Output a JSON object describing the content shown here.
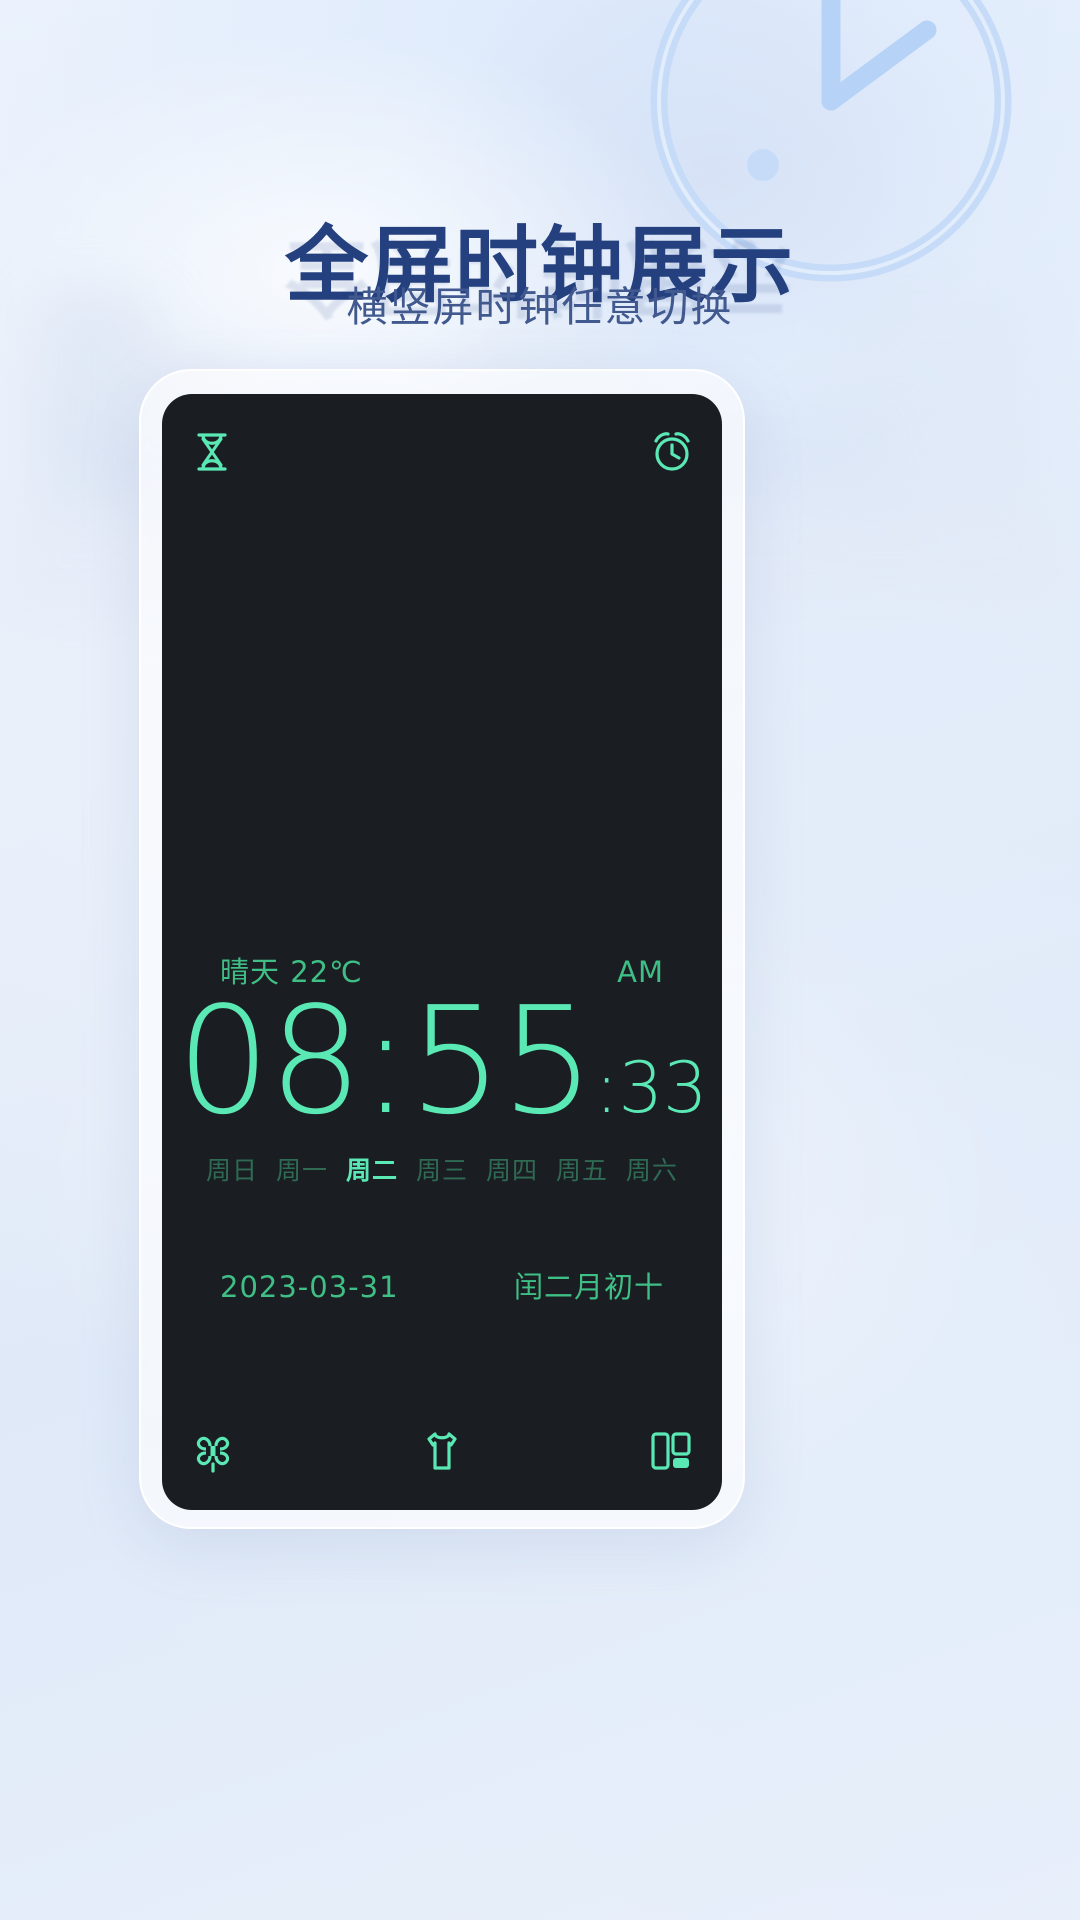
{
  "header": {
    "title": "全屏时钟展示",
    "subtitle": "横竖屏时钟任意切换"
  },
  "colors": {
    "title": "#24407f",
    "subtitle": "#41598f",
    "screen_bg": "#1a1e23",
    "accent_bright": "#5ae8b4",
    "accent_dim": "#3fbf85",
    "weekday_dim": "#2f6b53",
    "page_bg": "#e8f0fb"
  },
  "phone": {
    "topbar": {
      "left_icon": "hourglass-icon",
      "right_icon": "alarm-clock-icon"
    },
    "clock": {
      "weather": "晴天 22℃",
      "meridiem": "AM",
      "time": "08:55",
      "seconds": ":33",
      "weekdays": [
        {
          "label": "周日",
          "active": false
        },
        {
          "label": "周一",
          "active": false
        },
        {
          "label": "周二",
          "active": true
        },
        {
          "label": "周三",
          "active": false
        },
        {
          "label": "周四",
          "active": false
        },
        {
          "label": "周五",
          "active": false
        },
        {
          "label": "周六",
          "active": false
        }
      ],
      "date": "2023-03-31",
      "lunar": "闰二月初十"
    },
    "bottombar": {
      "left_icon": "clover-icon",
      "center_icon": "shirt-theme-icon",
      "right_icon": "layout-orientation-icon"
    }
  },
  "decor": {
    "clock_ring": "decorative-clock-icon"
  }
}
